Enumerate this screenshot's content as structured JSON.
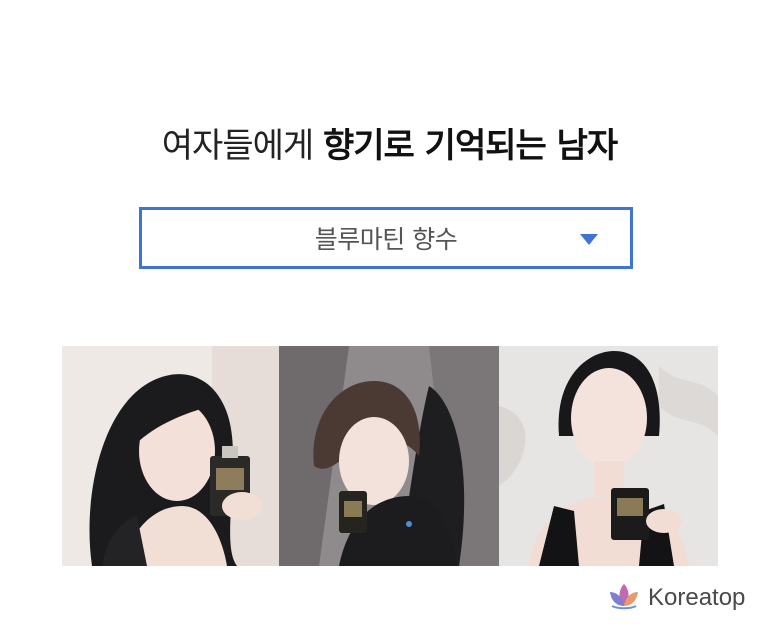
{
  "headline": {
    "regular": "여자들에게 ",
    "bold": "향기로 기억되는 남자"
  },
  "dropdown": {
    "selected": "블루마틴 향수",
    "icon": "triangle-down-icon",
    "accent_color": "#3f74d6"
  },
  "gallery": {
    "photos": [
      "photo-woman-holding-perfume-1",
      "photo-woman-holding-perfume-2",
      "photo-woman-holding-perfume-3"
    ]
  },
  "brand": {
    "name": "Koreatop",
    "icon": "lotus-logo-icon"
  }
}
